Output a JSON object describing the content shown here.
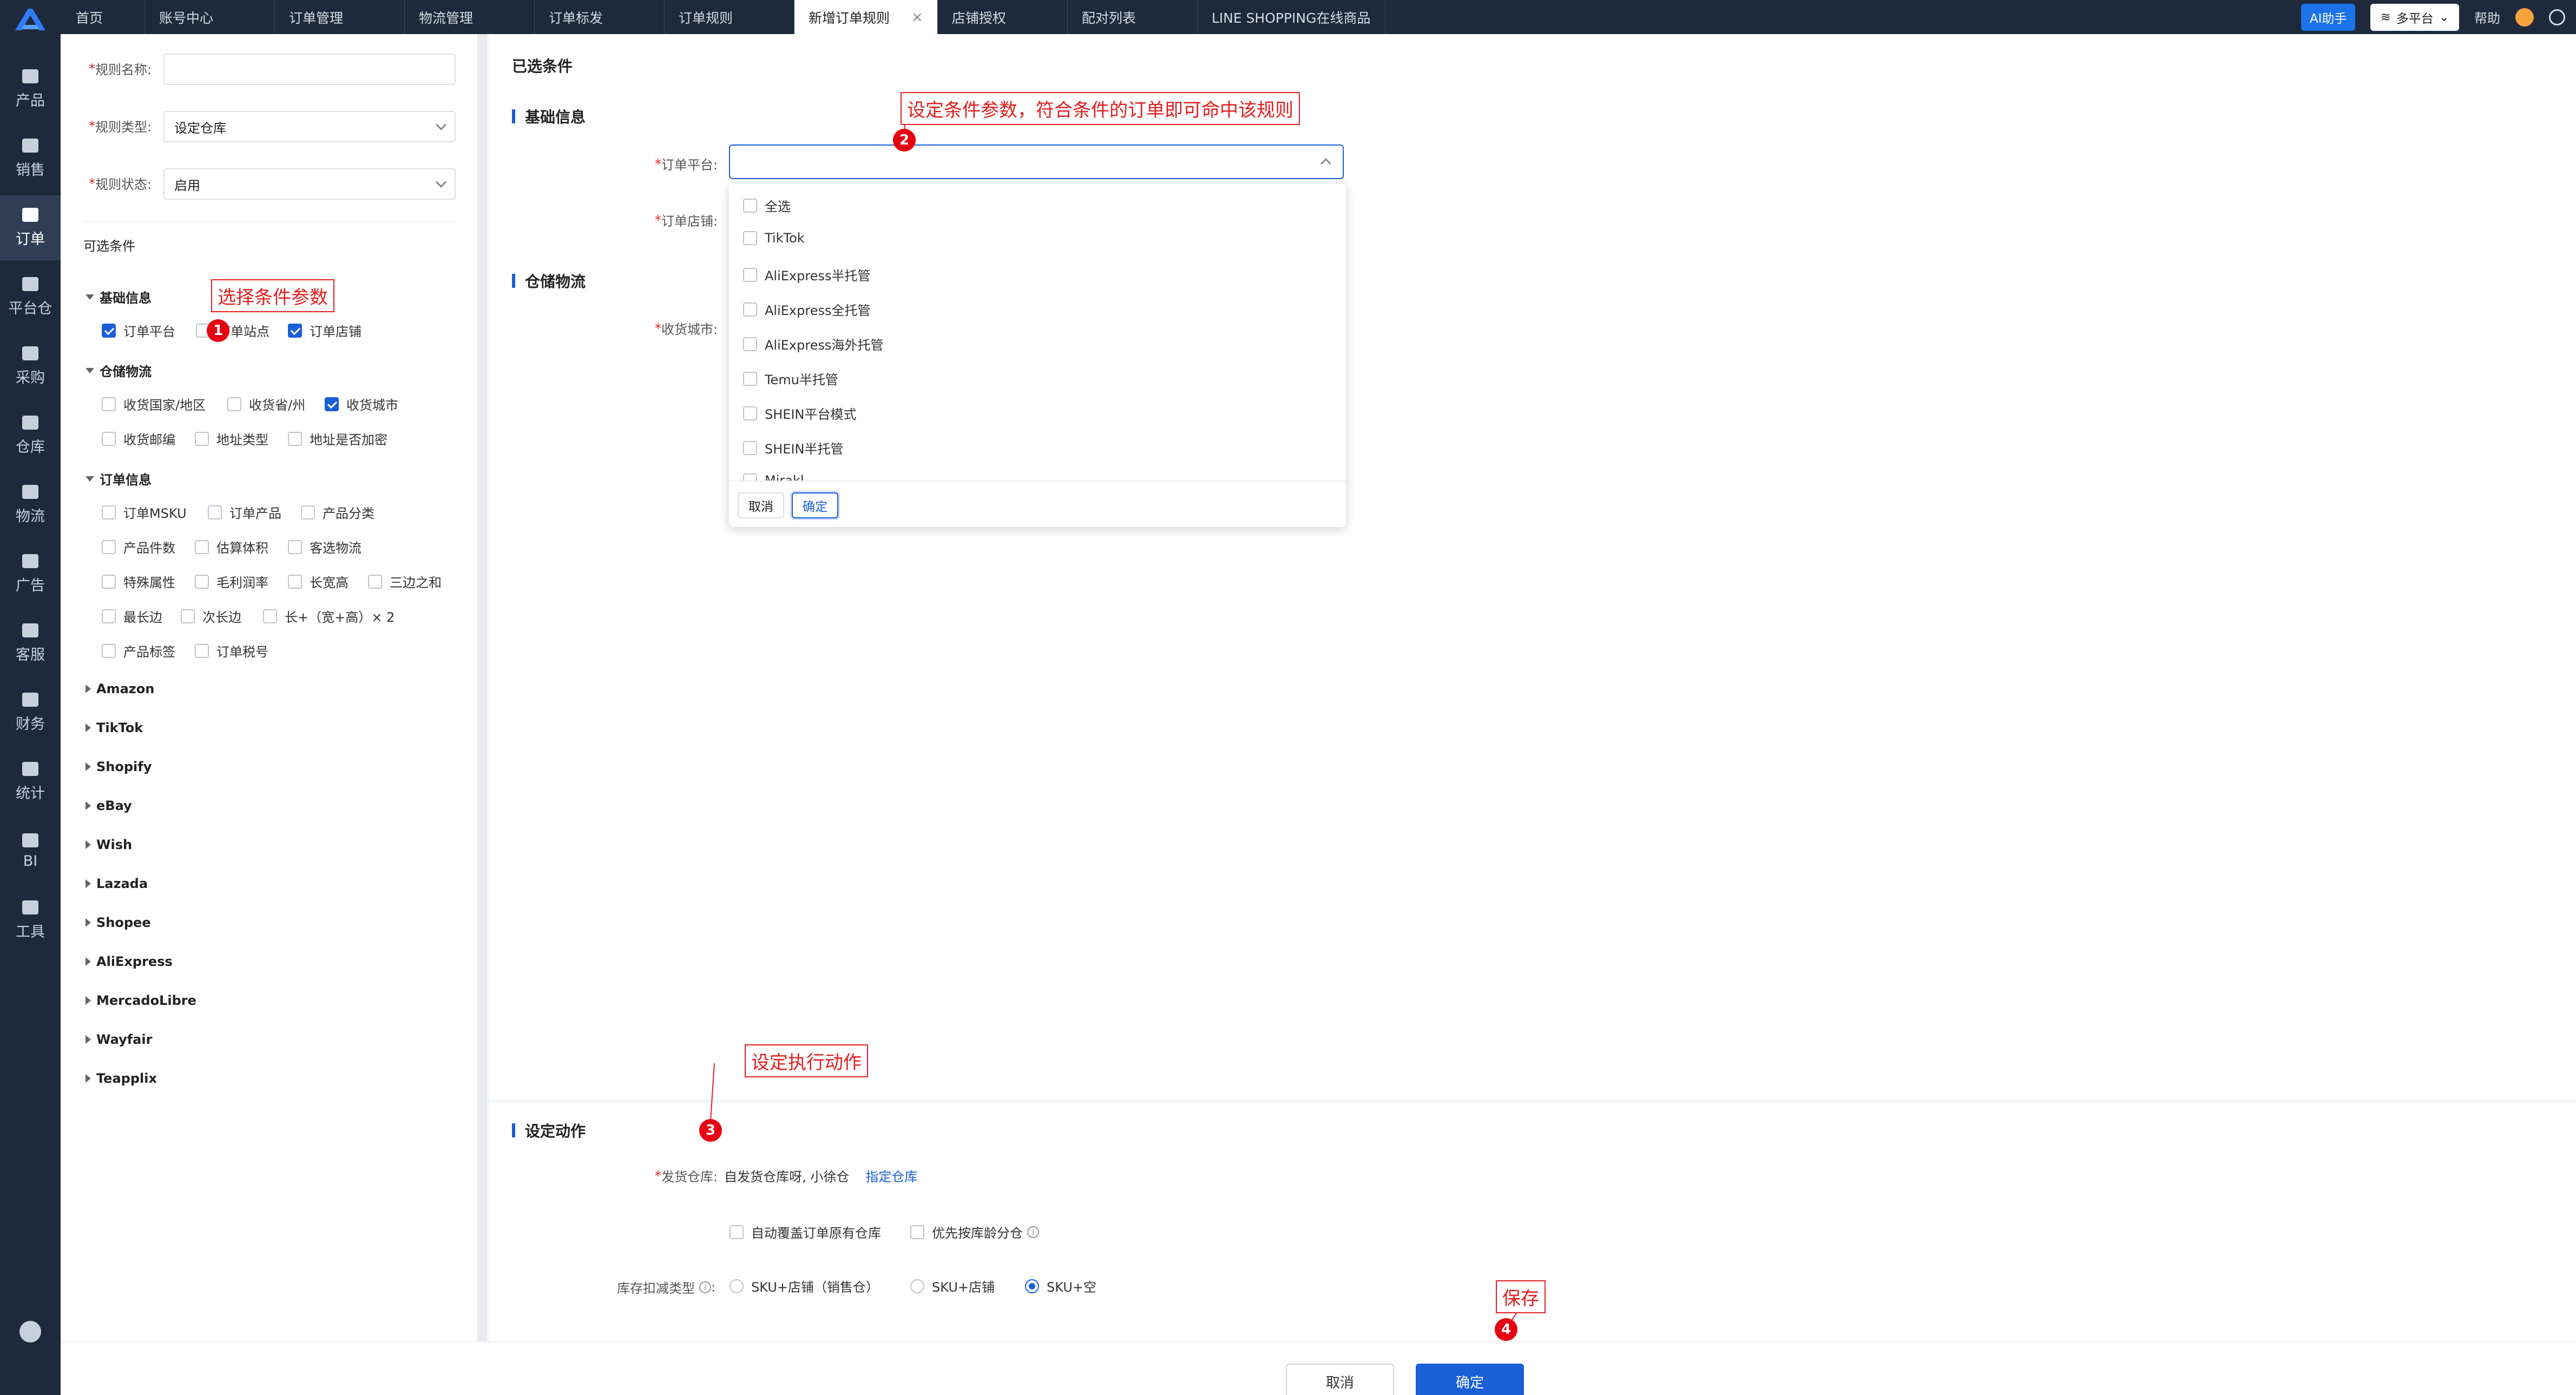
{
  "topbar": {
    "tabs": [
      {
        "label": "首页"
      },
      {
        "label": "账号中心"
      },
      {
        "label": "订单管理"
      },
      {
        "label": "物流管理"
      },
      {
        "label": "订单标发"
      },
      {
        "label": "订单规则"
      },
      {
        "label": "新增订单规则",
        "close": "×"
      },
      {
        "label": "店铺授权"
      },
      {
        "label": "配对列表"
      },
      {
        "label": "LINE SHOPPING在线商品"
      }
    ],
    "ai_label": "AI助手",
    "platform_label": "多平台",
    "help_label": "帮助"
  },
  "nav": {
    "items": [
      {
        "label": "产品",
        "icon": "product-icon"
      },
      {
        "label": "销售",
        "icon": "sales-icon"
      },
      {
        "label": "订单",
        "icon": "order-icon"
      },
      {
        "label": "平台仓",
        "icon": "platform-warehouse-icon"
      },
      {
        "label": "采购",
        "icon": "cart-icon"
      },
      {
        "label": "仓库",
        "icon": "warehouse-icon"
      },
      {
        "label": "物流",
        "icon": "truck-icon"
      },
      {
        "label": "广告",
        "icon": "ad-icon"
      },
      {
        "label": "客服",
        "icon": "mail-icon"
      },
      {
        "label": "财务",
        "icon": "finance-icon"
      },
      {
        "label": "统计",
        "icon": "pie-icon"
      },
      {
        "label": "BI",
        "icon": "bi-icon"
      },
      {
        "label": "工具",
        "icon": "tool-icon"
      }
    ]
  },
  "form": {
    "name_label": "规则名称:",
    "name_value": "",
    "type_label": "规则类型:",
    "type_value": "设定仓库",
    "status_label": "规则状态:",
    "status_value": "启用",
    "required_mark": "*"
  },
  "conditions": {
    "title": "可选条件",
    "basic": {
      "title": "基础信息",
      "items": [
        {
          "label": "订单平台",
          "checked": true
        },
        {
          "label": "订单站点",
          "checked": false
        },
        {
          "label": "订单店铺",
          "checked": true
        }
      ]
    },
    "warehouse": {
      "title": "仓储物流",
      "items": [
        {
          "label": "收货国家/地区",
          "checked": false
        },
        {
          "label": "收货省/州",
          "checked": false
        },
        {
          "label": "收货城市",
          "checked": true
        },
        {
          "label": "收货邮编",
          "checked": false
        },
        {
          "label": "地址类型",
          "checked": false
        },
        {
          "label": "地址是否加密",
          "checked": false
        }
      ]
    },
    "order": {
      "title": "订单信息",
      "items": [
        {
          "label": "订单MSKU"
        },
        {
          "label": "订单产品"
        },
        {
          "label": "产品分类"
        },
        {
          "label": "产品件数"
        },
        {
          "label": "估算体积"
        },
        {
          "label": "客选物流"
        },
        {
          "label": "特殊属性"
        },
        {
          "label": "毛利润率"
        },
        {
          "label": "长宽高"
        },
        {
          "label": "三边之和"
        },
        {
          "label": "最长边"
        },
        {
          "label": "次长边"
        },
        {
          "label": "长+（宽+高）× 2"
        },
        {
          "label": "产品标签"
        },
        {
          "label": "订单税号"
        }
      ]
    },
    "platforms": [
      "Amazon",
      "TikTok",
      "Shopify",
      "eBay",
      "Wish",
      "Lazada",
      "Shopee",
      "AliExpress",
      "MercadoLibre",
      "Wayfair",
      "Teapplix"
    ]
  },
  "main": {
    "selected_title": "已选条件",
    "basic_title": "基础信息",
    "platform_label": "订单平台:",
    "shop_label": "订单店铺:",
    "warehouse_title": "仓储物流",
    "city_label": "收货城市:",
    "dropdown": {
      "options": [
        "全选",
        "TikTok",
        "AliExpress半托管",
        "AliExpress全托管",
        "AliExpress海外托管",
        "Temu半托管",
        "SHEIN平台模式",
        "SHEIN半托管",
        "Mirakl"
      ],
      "cancel": "取消",
      "ok": "确定"
    },
    "action_title": "设定动作",
    "ship_label": "发货仓库:",
    "ship_value": "自发货仓库呀, 小徐仓",
    "ship_link": "指定仓库",
    "overwrite_label": "自动覆盖订单原有仓库",
    "priority_label": "优先按库龄分仓",
    "stock_label": "库存扣减类型",
    "stock_options": [
      {
        "label": "SKU+店铺（销售仓）",
        "selected": false
      },
      {
        "label": "SKU+店铺",
        "selected": false
      },
      {
        "label": "SKU+空",
        "selected": true
      }
    ]
  },
  "footer": {
    "cancel": "取消",
    "ok": "确定"
  },
  "annotations": {
    "note1": "选择条件参数",
    "note2": "设定条件参数，符合条件的订单即可命中该规则",
    "note3": "设定执行动作",
    "note4": "保存",
    "badge1": "1",
    "badge2": "2",
    "badge3": "3",
    "badge4": "4"
  },
  "colors": {
    "accent": "#1a5fd6",
    "nav_bg": "#1e2a3c",
    "annotation": "#e02020"
  }
}
